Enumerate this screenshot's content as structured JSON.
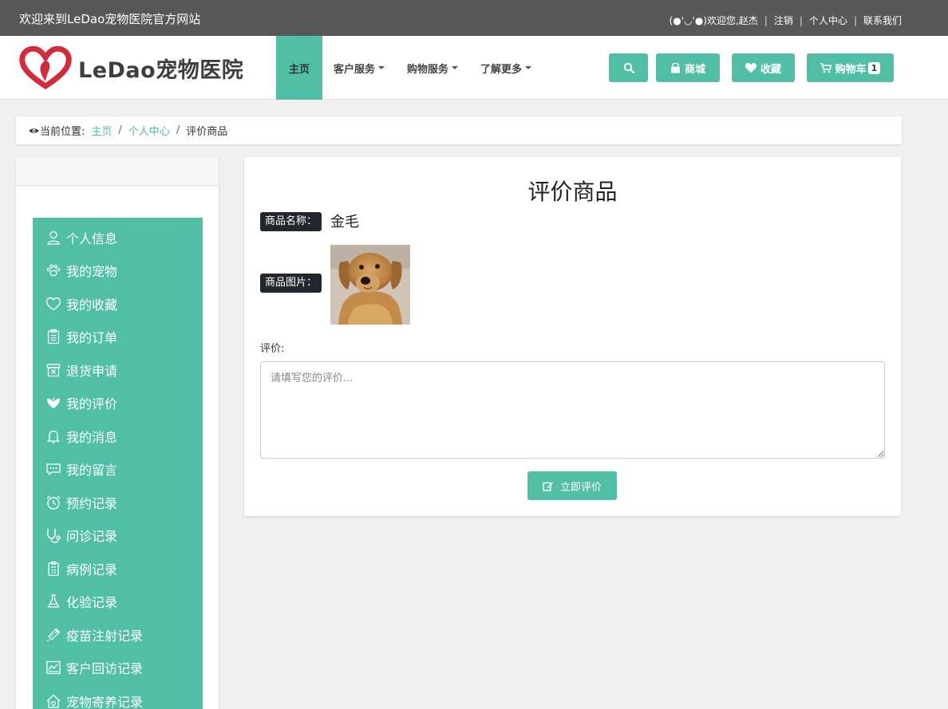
{
  "topbar": {
    "welcome": "欢迎来到LeDao宠物医院官方网站",
    "greeting": "(●'◡'●)欢迎您,赵杰",
    "logout": "注销",
    "personal_center": "个人中心",
    "contact": "联系我们"
  },
  "header": {
    "logo_text": "LeDao宠物医院",
    "nav": [
      {
        "label": "主页"
      },
      {
        "label": "客户服务"
      },
      {
        "label": "购物服务"
      },
      {
        "label": "了解更多"
      }
    ],
    "buttons": {
      "search_icon": "search-icon",
      "shop": "商城",
      "favorites": "收藏",
      "cart": "购物车",
      "cart_count": "1"
    }
  },
  "breadcrumb": {
    "prefix": "当前位置:",
    "items": [
      "主页",
      "个人中心",
      "评价商品"
    ]
  },
  "sidebar": {
    "items": [
      {
        "label": "个人信息",
        "icon": "user-icon"
      },
      {
        "label": "我的宠物",
        "icon": "paw-icon"
      },
      {
        "label": "我的收藏",
        "icon": "heart-icon"
      },
      {
        "label": "我的订单",
        "icon": "clipboard-icon"
      },
      {
        "label": "退货申请",
        "icon": "return-box-icon"
      },
      {
        "label": "我的评价",
        "icon": "rate-icon"
      },
      {
        "label": "我的消息",
        "icon": "bell-icon"
      },
      {
        "label": "我的留言",
        "icon": "chat-icon"
      },
      {
        "label": "预约记录",
        "icon": "alarm-icon"
      },
      {
        "label": "问诊记录",
        "icon": "stethoscope-icon"
      },
      {
        "label": "病例记录",
        "icon": "case-icon"
      },
      {
        "label": "化验记录",
        "icon": "flask-icon"
      },
      {
        "label": "疫苗注射记录",
        "icon": "syringe-icon"
      },
      {
        "label": "客户回访记录",
        "icon": "chart-icon"
      },
      {
        "label": "宠物寄养记录",
        "icon": "house-icon"
      }
    ]
  },
  "review": {
    "title": "评价商品",
    "name_label": "商品名称：",
    "product_name": "金毛",
    "image_label": "商品图片：",
    "comment_label": "评价:",
    "placeholder": "请填写您的评价...",
    "submit": "立即评价"
  },
  "colors": {
    "accent": "#50bfa5",
    "topbar": "#585858",
    "tag": "#23272b"
  }
}
